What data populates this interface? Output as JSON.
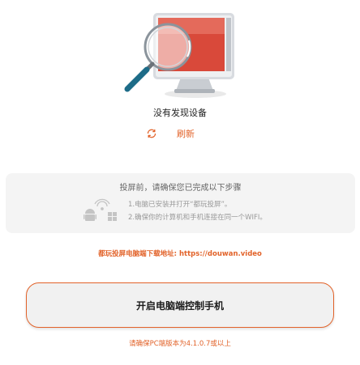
{
  "status": {
    "no_device": "没有发现设备"
  },
  "refresh": {
    "label": "刷新",
    "icon": "refresh-icon"
  },
  "instructions": {
    "title": "投屏前，请确保您已完成以下步骤",
    "steps": [
      "1.电脑已安装并打开“都玩投屏”。",
      "2.确保你的计算机和手机连接在同一个WIFI。"
    ],
    "icons": [
      "wifi-icon",
      "android-icon",
      "windows-icon"
    ]
  },
  "download_hint": "都玩投屏电脑端下载地址: https://douwan.video",
  "primary_button": {
    "label": "开启电脑端控制手机"
  },
  "version_note": "请确保PC端版本为4.1.0.7或以上",
  "colors": {
    "accent": "#e2632a",
    "screen_red": "#d9493a",
    "card_bg": "#f4f4f4",
    "button_bg": "#f1f1f1"
  }
}
